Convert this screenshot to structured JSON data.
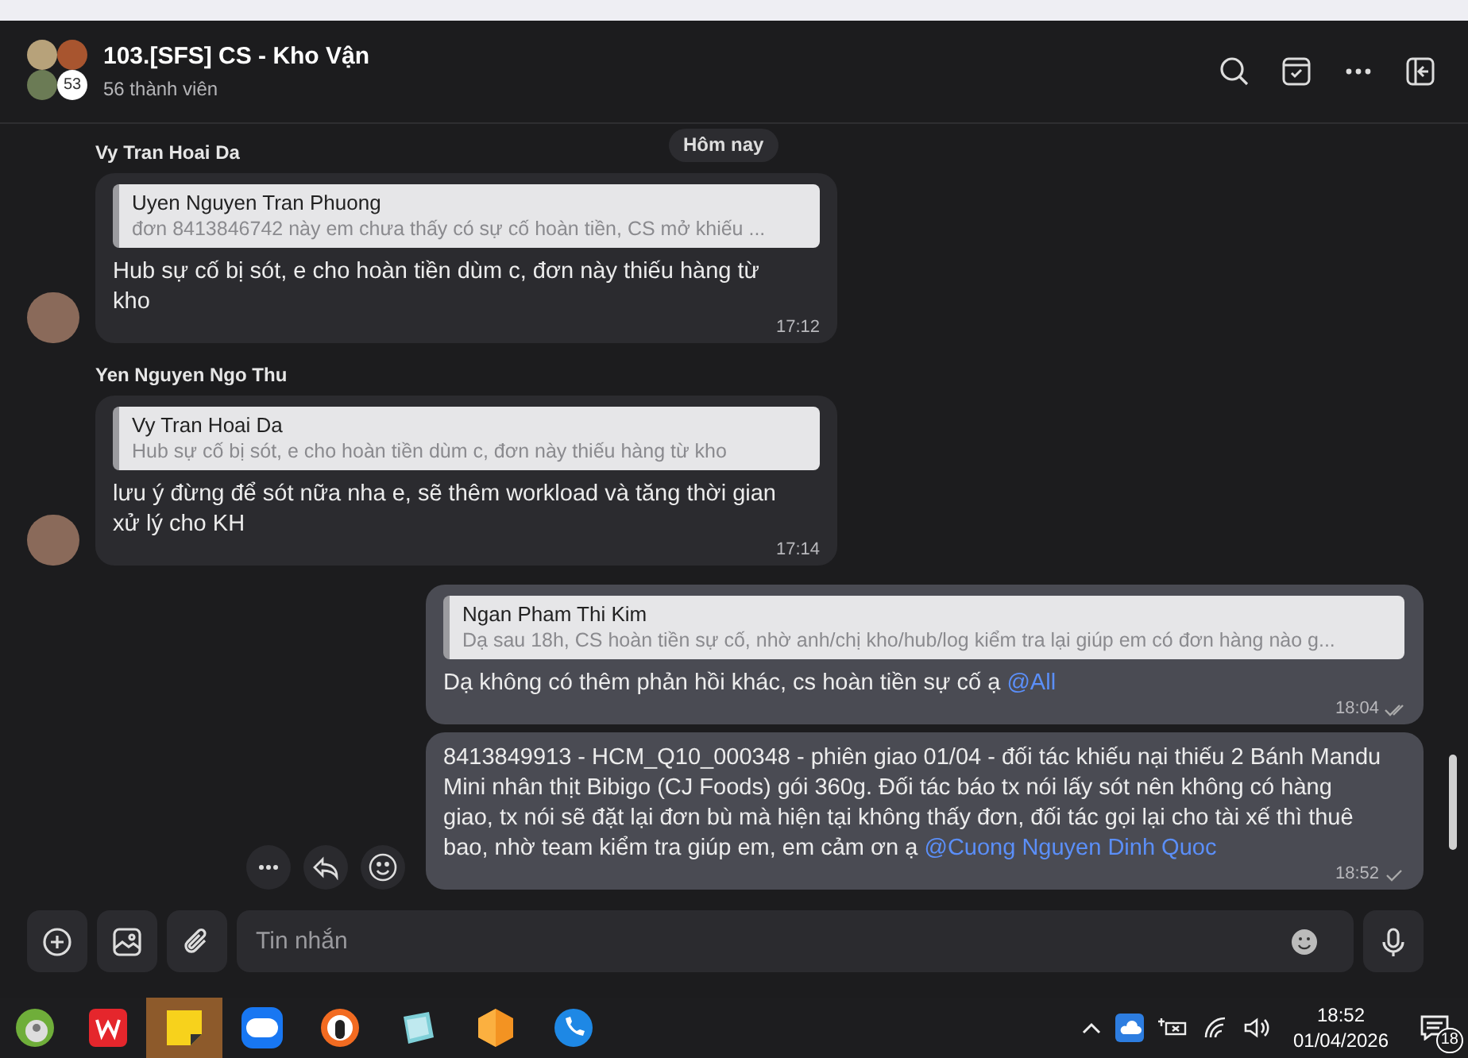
{
  "chat": {
    "title": "103.[SFS] CS - Kho Vận",
    "subtitle": "56 thành viên",
    "member_badge": "53"
  },
  "date_divider": "Hôm nay",
  "messages": [
    {
      "kind": "incoming",
      "sender": "Vy Tran Hoai Da",
      "quote": {
        "author": "Uyen Nguyen Tran Phuong",
        "text": "đơn 8413846742 này em chưa thấy có sự cố hoàn tiền, CS mở khiếu ..."
      },
      "text": "Hub sự cố bị sót, e cho hoàn tiền dùm c, đơn này thiếu hàng từ kho",
      "time": "17:12"
    },
    {
      "kind": "incoming",
      "sender": "Yen Nguyen Ngo Thu",
      "quote": {
        "author": "Vy Tran Hoai Da",
        "text": "Hub sự cố bị sót, e cho hoàn tiền dùm c, đơn này thiếu hàng từ kho"
      },
      "text": "lưu ý đừng để sót nữa nha e, sẽ thêm workload và tăng thời gian xử lý cho KH",
      "time": "17:14"
    },
    {
      "kind": "outgoing",
      "quote": {
        "author": "Ngan Pham Thi Kim",
        "text": "Dạ sau 18h, CS hoàn tiền sự cố, nhờ anh/chị kho/hub/log kiểm tra lại giúp em có đơn hàng nào g..."
      },
      "text": "Dạ không có thêm phản hồi khác, cs hoàn tiền sự cố ạ",
      "mention": "@All",
      "time": "18:04",
      "seen": true,
      "hovered": false
    },
    {
      "kind": "outgoing",
      "text": "8413849913 - HCM_Q10_000348 - phiên giao 01/04 - đối tác khiếu nại thiếu 2 Bánh Mandu Mini nhân thịt Bibigo (CJ Foods) gói 360g. Đối tác báo tx nói lấy sót nên không có hàng giao, tx nói sẽ đặt lại đơn bù mà hiện tại không thấy đơn, đối tác gọi lại cho tài xế thì thuê bao, nhờ team kiểm tra giúp em, em cảm ơn ạ",
      "mention": "@Cuong Nguyen Dinh Quoc",
      "time": "18:52",
      "seen": false,
      "hovered": true
    }
  ],
  "composer": {
    "placeholder": "Tin nhắn"
  },
  "taskbar": {
    "time": "18:52",
    "date": "01/04/2026",
    "notification_count": "18"
  }
}
